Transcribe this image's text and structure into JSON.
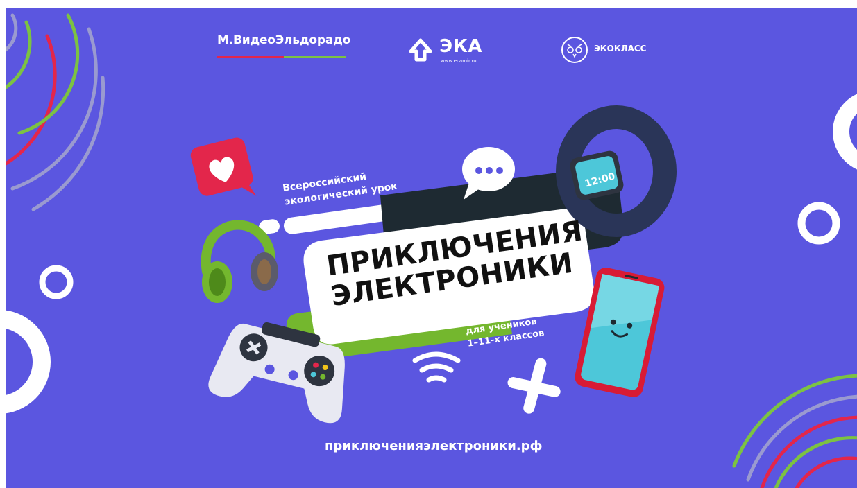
{
  "logos": {
    "mvideo": "М.ВидеоЭльдорадо",
    "eka": "ЭКА",
    "eka_url": "www.ecamir.ru",
    "ekoklass": "ЭКОКЛАСС"
  },
  "banner": {
    "subtitle_line1": "Всероссийский",
    "subtitle_line2": "экологический урок",
    "title_line1": "ПРИКЛЮЧЕНИЯ",
    "title_line2": "ЭЛЕКТРОНИКИ",
    "audience_line1": "для учеников",
    "audience_line2": "1–11-х классов",
    "watch_time": "12:00",
    "website": "приключенияэлектроники.рф"
  },
  "colors": {
    "background": "#5b56e0",
    "accent_red": "#e3264b",
    "accent_green": "#7cc242",
    "dark_panel": "#1e2a32"
  },
  "icons": [
    "heart-like-icon",
    "chat-bubble-icon",
    "smartwatch-icon",
    "headphones-icon",
    "gamepad-icon",
    "smartphone-icon",
    "wifi-icon",
    "cross-icon",
    "eka-arrow-icon",
    "owl-icon"
  ]
}
